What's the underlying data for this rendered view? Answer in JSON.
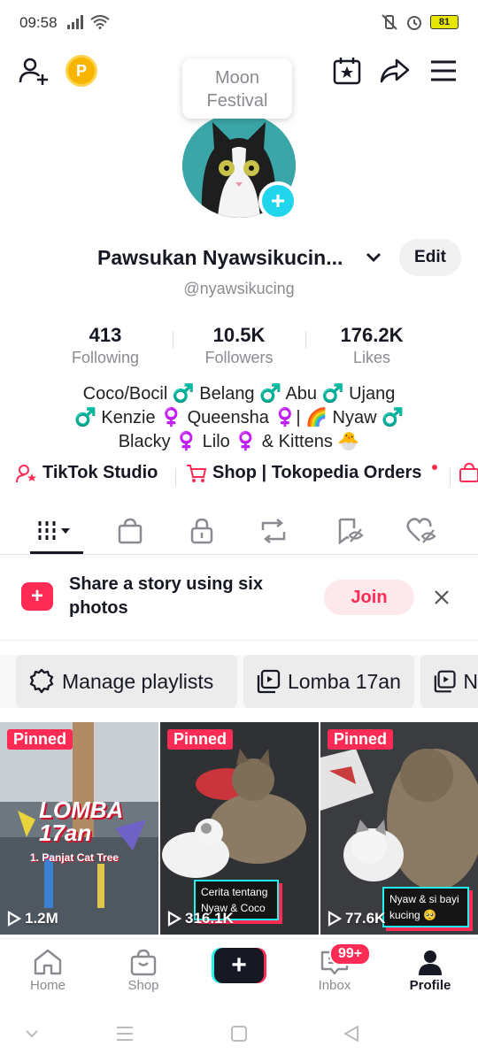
{
  "status_bar": {
    "time": "09:58",
    "battery": "81"
  },
  "top_nav": {
    "coin_letter": "P"
  },
  "profile": {
    "bubble_line1": "Moon",
    "bubble_line2": "Festival",
    "name": "Pawsukan Nyawsikucin...",
    "handle": "@nyawsikucing",
    "edit_label": "Edit"
  },
  "stats": [
    {
      "value": "413",
      "label": "Following"
    },
    {
      "value": "10.5K",
      "label": "Followers"
    },
    {
      "value": "176.2K",
      "label": "Likes"
    }
  ],
  "bio": {
    "line1": "Coco/Bocil ♂️ Belang ♂️ Abu ♂️ Ujang",
    "line2": "♂️ Kenzie ♀️ Queensha ♀️| 🌈 Nyaw ♂️",
    "line3": "Blacky ♀️ Lilo ♀️ & Kittens 🐣"
  },
  "links": {
    "studio": "TikTok Studio",
    "shop": "Shop | Tokopedia Orders"
  },
  "story": {
    "text": "Share a story using six photos",
    "join_label": "Join"
  },
  "playlists": [
    {
      "label": "Manage playlists"
    },
    {
      "label": "Lomba 17an"
    },
    {
      "label": "N"
    }
  ],
  "videos": [
    {
      "badge": "Pinned",
      "views": "1.2M",
      "title": "LOMBA 17an",
      "subtitle": "1. Panjat Cat Tree"
    },
    {
      "badge": "Pinned",
      "views": "316.1K",
      "caption_line1": "Cerita tentang",
      "caption_line2": "Nyaw & Coco"
    },
    {
      "badge": "Pinned",
      "views": "77.6K",
      "caption_line1": "Nyaw & si bayi",
      "caption_line2": "kucing 🥺"
    }
  ],
  "bottom_nav": {
    "home": "Home",
    "shop": "Shop",
    "inbox": "Inbox",
    "inbox_badge": "99+",
    "profile": "Profile"
  },
  "colors": {
    "accent": "#fe2c55",
    "cyan": "#25f4ee",
    "text": "#161823",
    "muted": "#8a8b91"
  }
}
